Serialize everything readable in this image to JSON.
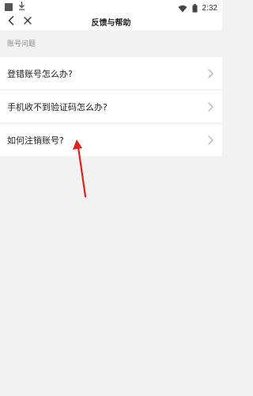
{
  "status_bar": {
    "time": "2:32",
    "icons": [
      "app-icon",
      "download-icon",
      "wifi-icon",
      "battery-icon"
    ]
  },
  "header": {
    "title": "反馈与帮助",
    "back_icon": "back-chevron-icon",
    "close_icon": "close-icon"
  },
  "section": {
    "title": "账号问题"
  },
  "list": {
    "items": [
      {
        "label": "登错账号怎么办?"
      },
      {
        "label": "手机收不到验证码怎么办?"
      },
      {
        "label": "如何注销账号?"
      }
    ]
  },
  "colors": {
    "background": "#f2f2f2",
    "surface": "#ffffff",
    "annotation_arrow": "#e0221f"
  }
}
